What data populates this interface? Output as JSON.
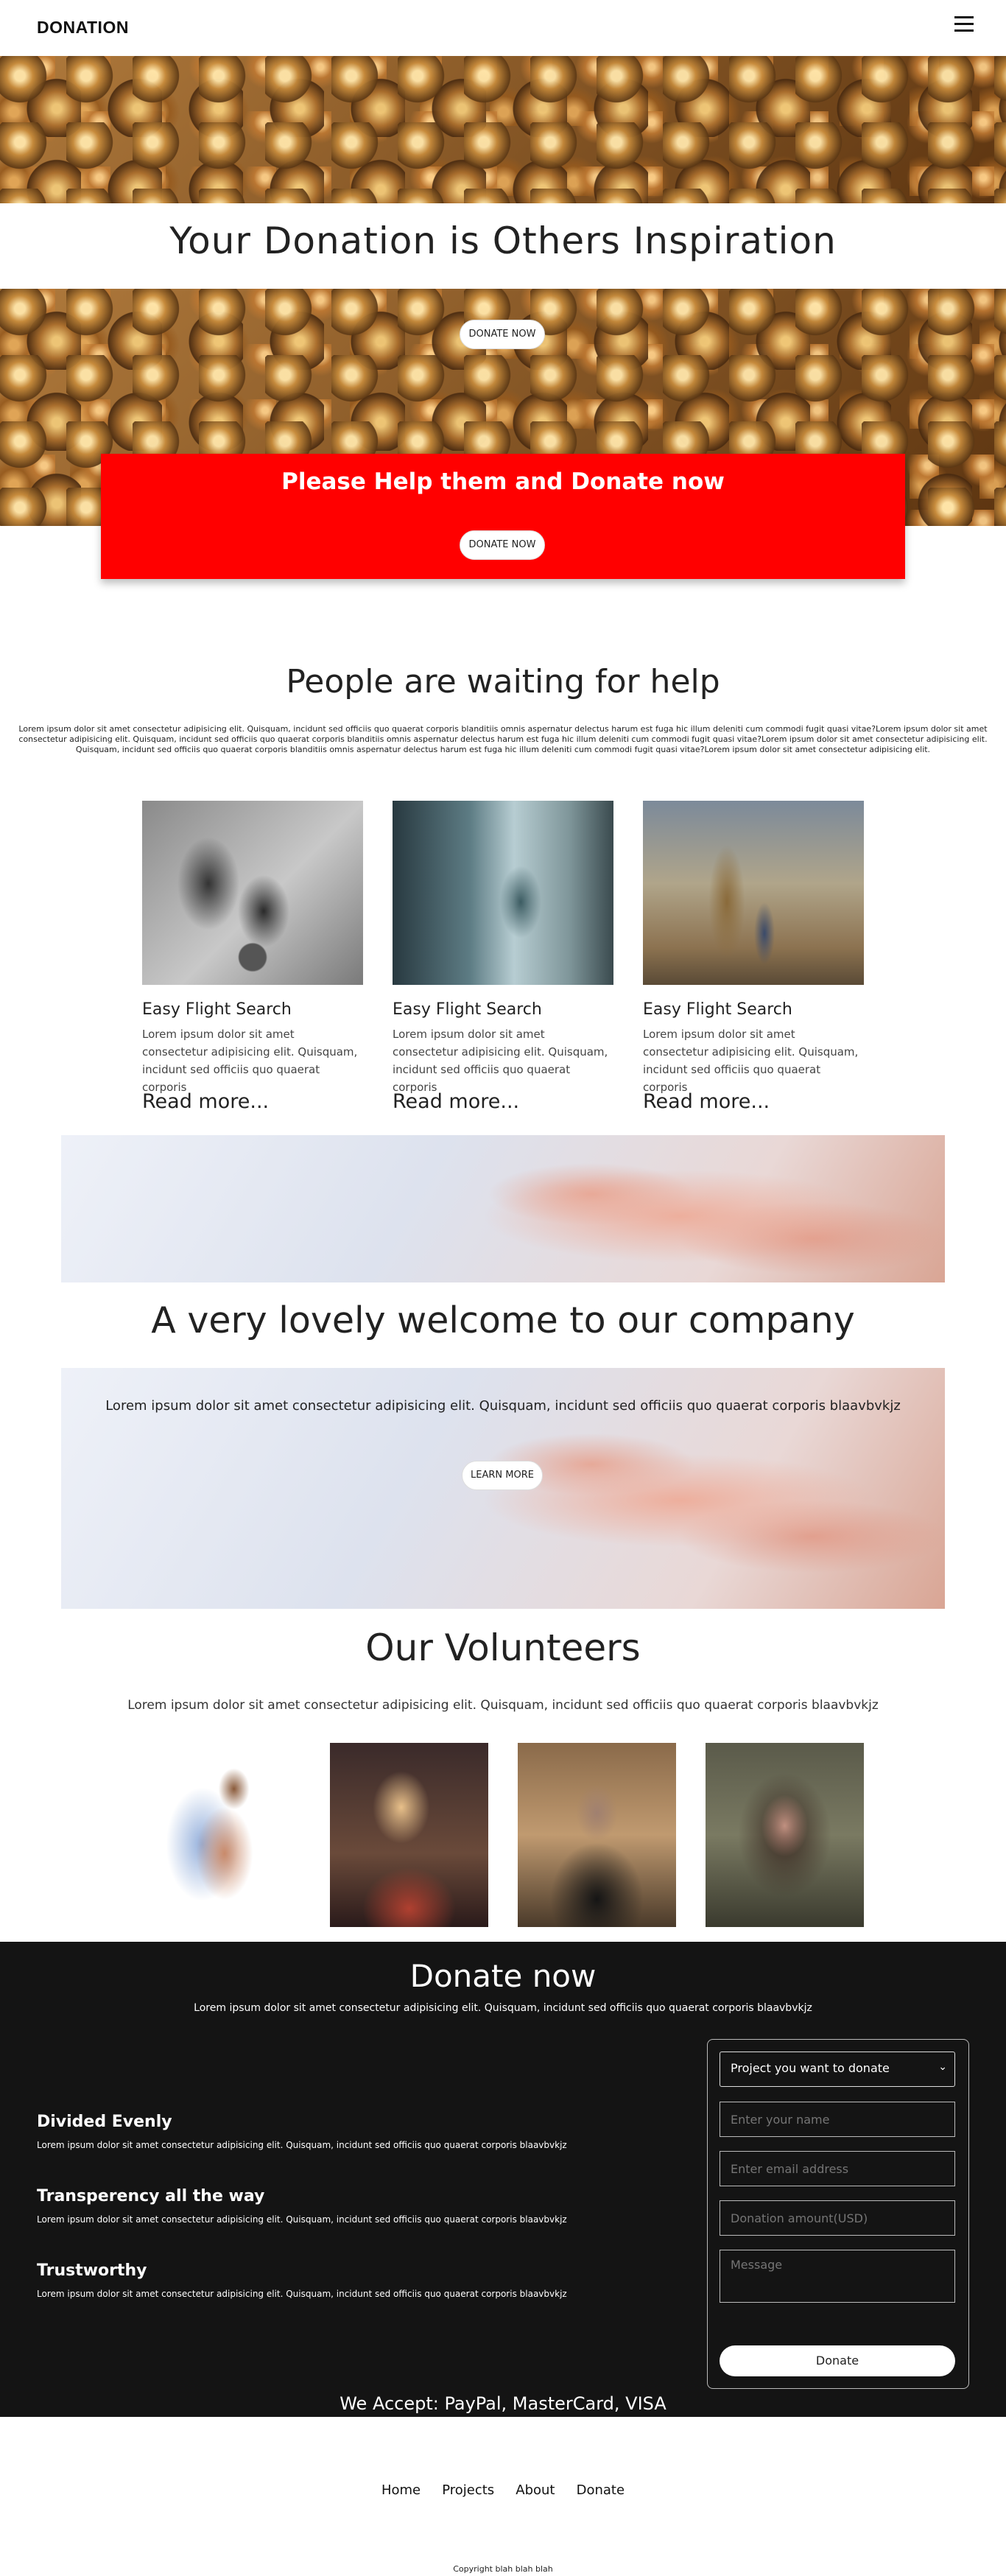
{
  "nav": {
    "brand": "DONATION",
    "menu_icon": "hamburger-menu-icon"
  },
  "hero": {
    "title": "Your Donation is Others Inspiration",
    "donate_button": "DONATE NOW"
  },
  "banner": {
    "title": "Please Help them and Donate now",
    "donate_button": "DONATE NOW",
    "color": "#ff0000"
  },
  "waiting": {
    "title": "People are waiting for help",
    "text": "Lorem ipsum dolor sit amet consectetur adipisicing elit. Quisquam, incidunt sed officiis quo quaerat corporis blanditiis omnis aspernatur delectus harum est fuga hic illum deleniti cum commodi fugit quasi vitae?Lorem ipsum dolor sit amet consectetur adipisicing elit. Quisquam, incidunt sed officiis quo quaerat corporis blanditiis omnis aspernatur delectus harum est fuga hic illum deleniti cum commodi fugit quasi vitae?Lorem ipsum dolor sit amet consectetur adipisicing elit. Quisquam, incidunt sed officiis quo quaerat corporis blanditiis omnis aspernatur delectus harum est fuga hic illum deleniti cum commodi fugit quasi vitae?Lorem ipsum dolor sit amet consectetur adipisicing elit.",
    "cards": [
      {
        "title": "Easy Flight Search",
        "text": "Lorem ipsum dolor sit amet consectetur adipisicing elit. Quisquam, incidunt sed officiis quo quaerat corporis",
        "more": "Read more..."
      },
      {
        "title": "Easy Flight Search",
        "text": "Lorem ipsum dolor sit amet consectetur adipisicing elit. Quisquam, incidunt sed officiis quo quaerat corporis",
        "more": "Read more..."
      },
      {
        "title": "Easy Flight Search",
        "text": "Lorem ipsum dolor sit amet consectetur adipisicing elit. Quisquam, incidunt sed officiis quo quaerat corporis",
        "more": "Read more..."
      }
    ]
  },
  "welcome": {
    "title": "A very lovely welcome to our company",
    "text": "Lorem ipsum dolor sit amet consectetur adipisicing elit. Quisquam, incidunt sed officiis quo quaerat corporis blaavbvkjz",
    "button": "LEARN MORE"
  },
  "volunteers": {
    "title": "Our Volunteers",
    "text": "Lorem ipsum dolor sit amet consectetur adipisicing elit. Quisquam, incidunt sed officiis quo quaerat corporis blaavbvkjz"
  },
  "donate": {
    "title": "Donate now",
    "subtitle": "Lorem ipsum dolor sit amet consectetur adipisicing elit. Quisquam, incidunt sed officiis quo quaerat corporis blaavbvkjz",
    "features": [
      {
        "title": "Divided Evenly",
        "text": "Lorem ipsum dolor sit amet consectetur adipisicing elit. Quisquam, incidunt sed officiis quo quaerat corporis blaavbvkjz"
      },
      {
        "title": "Transperency all the way",
        "text": "Lorem ipsum dolor sit amet consectetur adipisicing elit. Quisquam, incidunt sed officiis quo quaerat corporis blaavbvkjz"
      },
      {
        "title": "Trustworthy",
        "text": "Lorem ipsum dolor sit amet consectetur adipisicing elit. Quisquam, incidunt sed officiis quo quaerat corporis blaavbvkjz"
      }
    ],
    "form": {
      "project_select": "Project you want to donate",
      "name_placeholder": "Enter your name",
      "email_placeholder": "Enter email address",
      "amount_placeholder": "Donation amount(USD)",
      "message_placeholder": "Message",
      "submit": "Donate"
    },
    "accept": "We Accept: PayPal, MasterCard, VISA"
  },
  "footer": {
    "links": [
      "Home",
      "Projects",
      "About",
      "Donate"
    ],
    "copyright": "Copyright blah blah blah"
  }
}
